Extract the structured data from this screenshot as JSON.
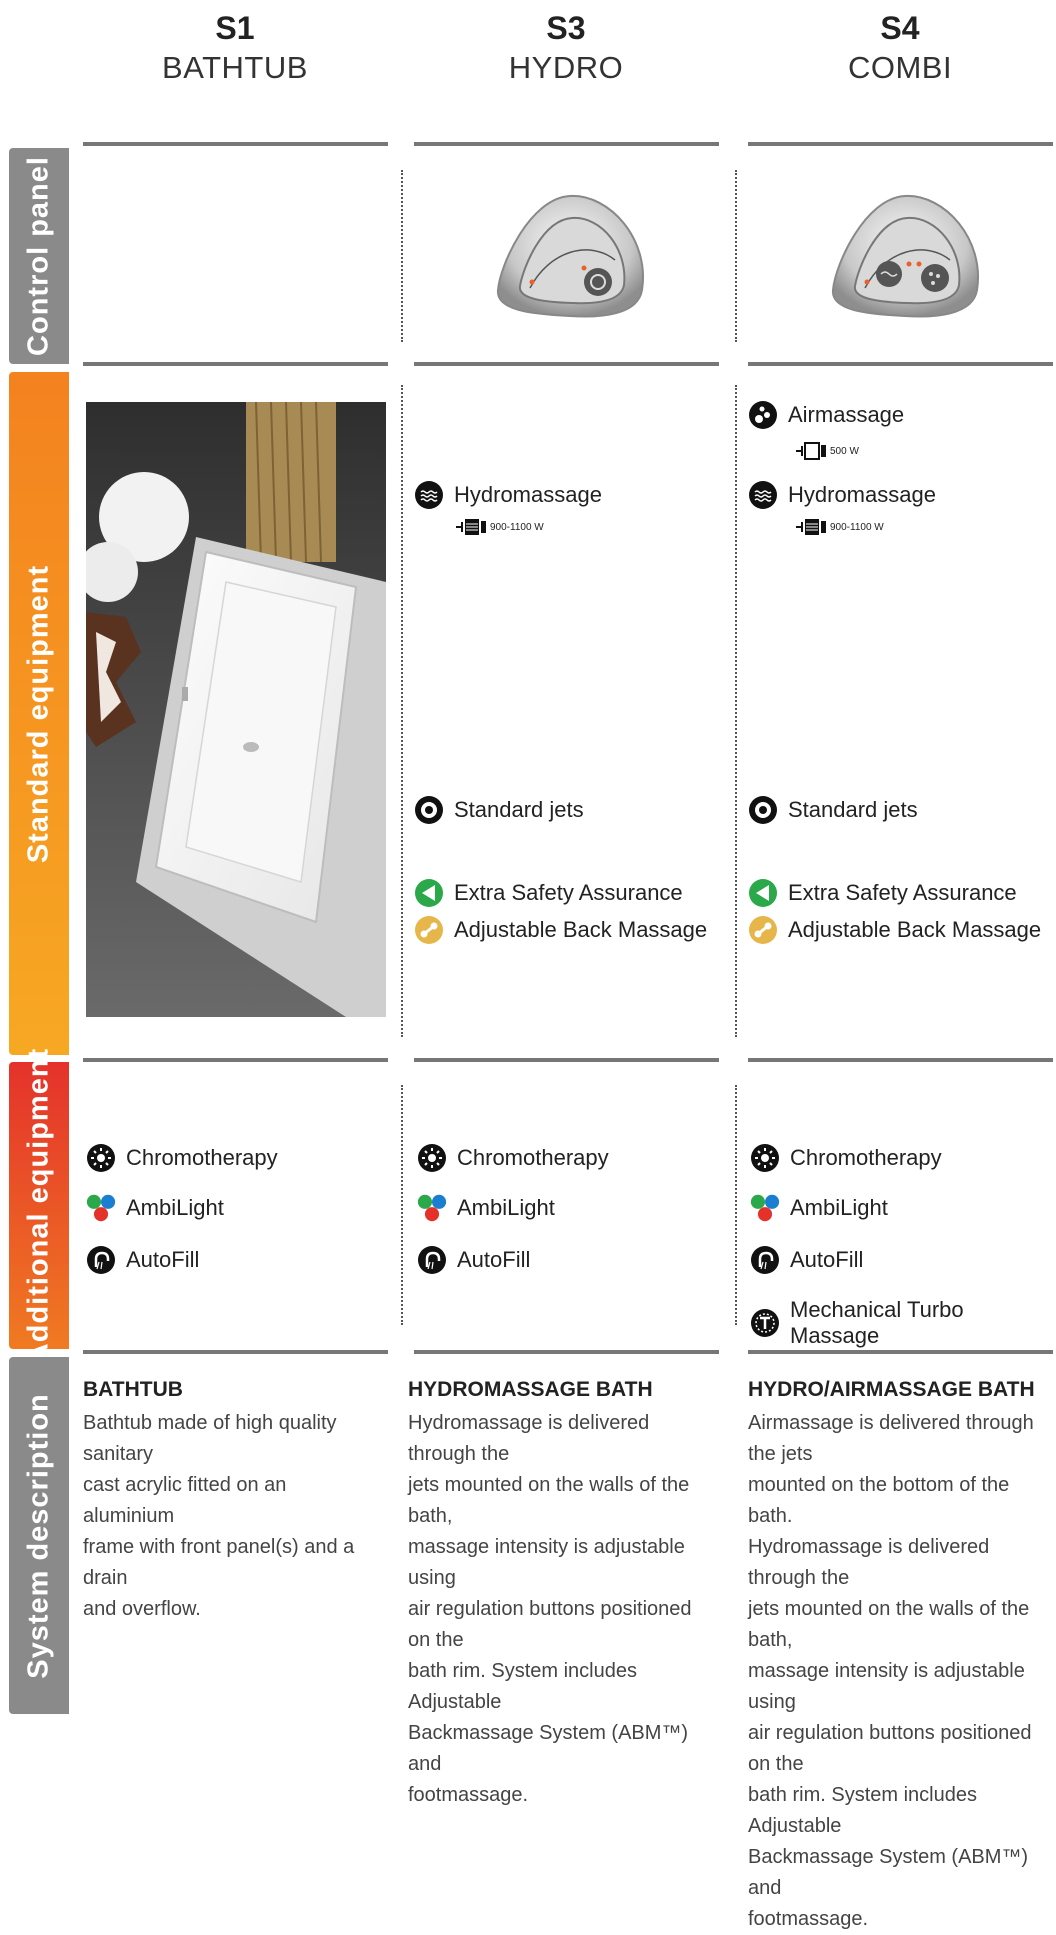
{
  "columns": [
    {
      "code": "S1",
      "name": "BATHTUB"
    },
    {
      "code": "S3",
      "name": "HYDRO"
    },
    {
      "code": "S4",
      "name": "COMBI"
    }
  ],
  "rows": {
    "control_panel": "Control panel",
    "standard_equipment": "Standard equipment",
    "additional_equipment": "Additional equipment",
    "system_description": "System description"
  },
  "colors": {
    "control_panel": "#8a8a8a",
    "standard_top": "#f4821f",
    "standard_bottom": "#f7a823",
    "additional_top": "#e4322b",
    "additional_bottom": "#f07a22",
    "description": "#8a8a8a",
    "extra_safety": "#2aa84a",
    "back_massage": "#e6b64a"
  },
  "standard": {
    "s3": {
      "hydromassage": "Hydromassage",
      "hydromassage_watt": "900-1100 W",
      "standard_jets": "Standard jets",
      "extra_safety": "Extra Safety Assurance",
      "back_massage": "Adjustable Back Massage"
    },
    "s4": {
      "airmassage": "Airmassage",
      "airmassage_watt": "500 W",
      "hydromassage": "Hydromassage",
      "hydromassage_watt": "900-1100 W",
      "standard_jets": "Standard jets",
      "extra_safety": "Extra Safety Assurance",
      "back_massage": "Adjustable Back Massage"
    }
  },
  "additional": {
    "s1": [
      "Chromotherapy",
      "AmbiLight",
      "AutoFill"
    ],
    "s3": [
      "Chromotherapy",
      "AmbiLight",
      "AutoFill"
    ],
    "s4": [
      "Chromotherapy",
      "AmbiLight",
      "AutoFill",
      "Mechanical Turbo Massage"
    ]
  },
  "descriptions": {
    "s1": {
      "title": "BATHTUB",
      "lines": [
        "Bathtub made of high quality sanitary",
        "cast acrylic fitted on an aluminium",
        "frame with front panel(s) and a drain",
        "and overflow."
      ]
    },
    "s3": {
      "title": "HYDROMASSAGE BATH",
      "lines": [
        "Hydromassage is delivered through the",
        "jets mounted on the walls of the bath,",
        "massage intensity is adjustable using",
        "air regulation buttons positioned on the",
        "bath rim. System includes Adjustable",
        "Backmassage System (ABM™) and",
        "footmassage."
      ]
    },
    "s4": {
      "title": "HYDRO/AIRMASSAGE BATH",
      "lines": [
        "Airmassage is delivered through the jets",
        "mounted on the bottom of the bath.",
        "Hydromassage is delivered through the",
        "jets mounted on the walls of the bath,",
        "massage intensity is adjustable using",
        "air regulation buttons positioned on the",
        "bath rim. System includes Adjustable",
        "Backmassage System (ABM™) and",
        "footmassage."
      ]
    }
  }
}
